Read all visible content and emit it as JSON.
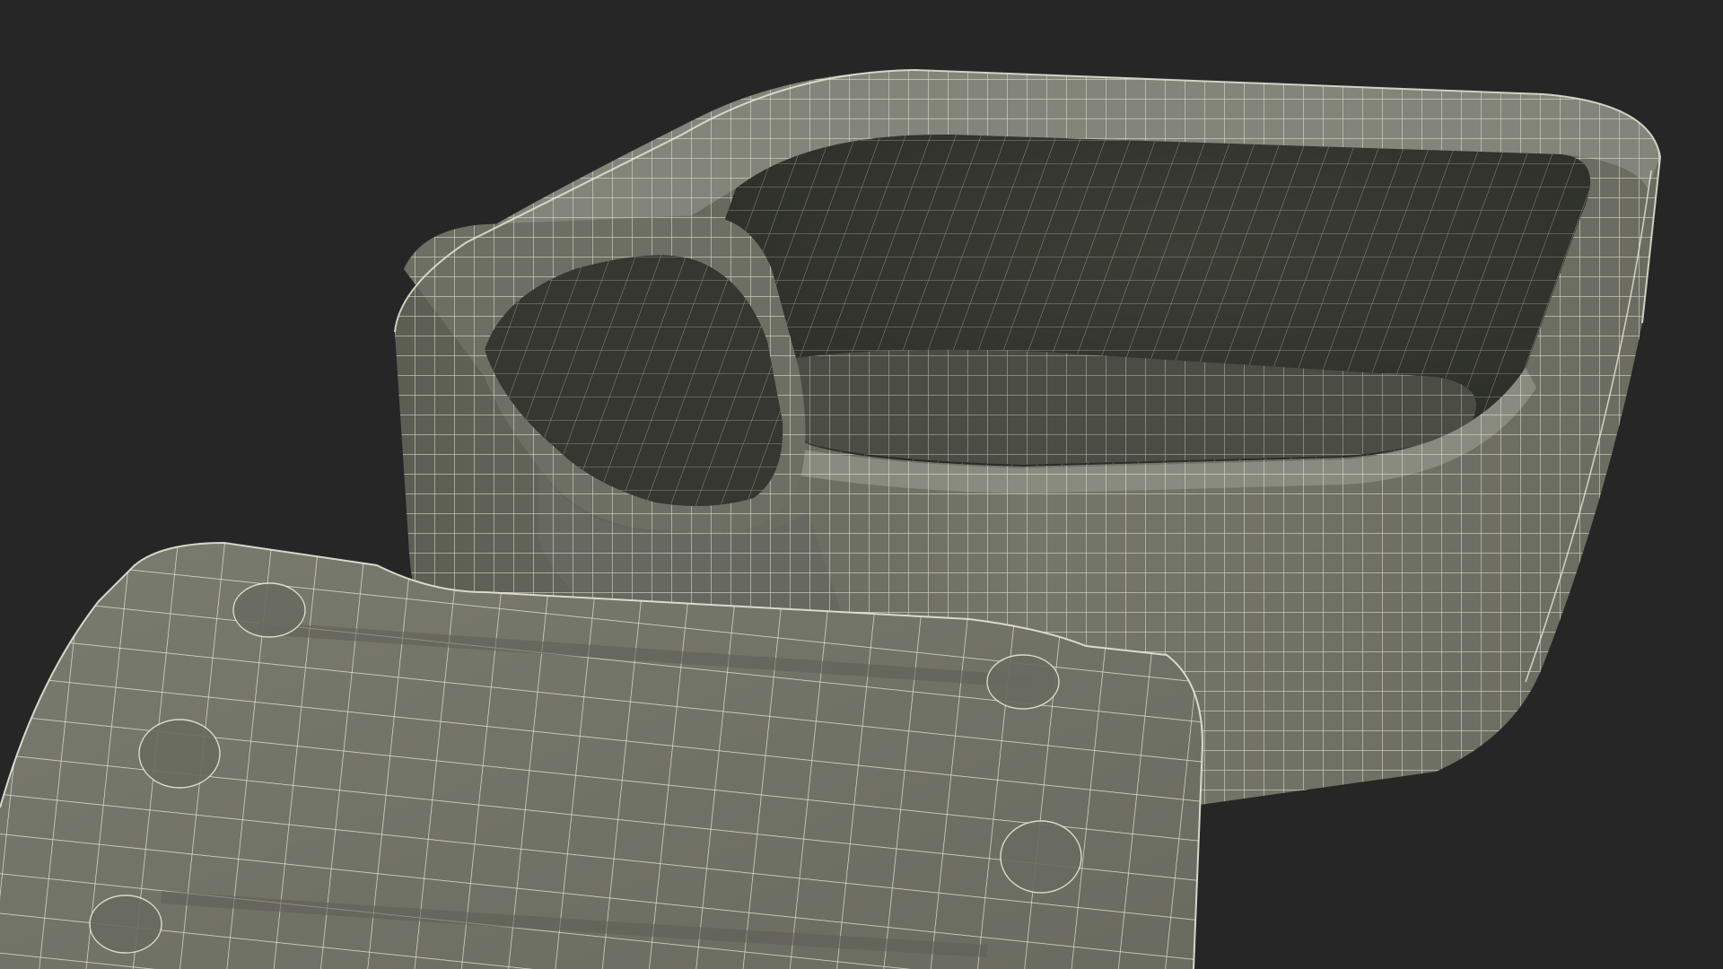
{
  "scene": {
    "subject": "open-tin-can-wireframe-render",
    "colors": {
      "background": "#262626",
      "shell": "#75766a",
      "shell_light": "#83847a",
      "shell_dark": "#5c5d53",
      "interior": "#33352e",
      "interior_floor": "#4b4d44",
      "wire": "#e6e6d8",
      "wire_dim": "#c8c8b8"
    }
  }
}
